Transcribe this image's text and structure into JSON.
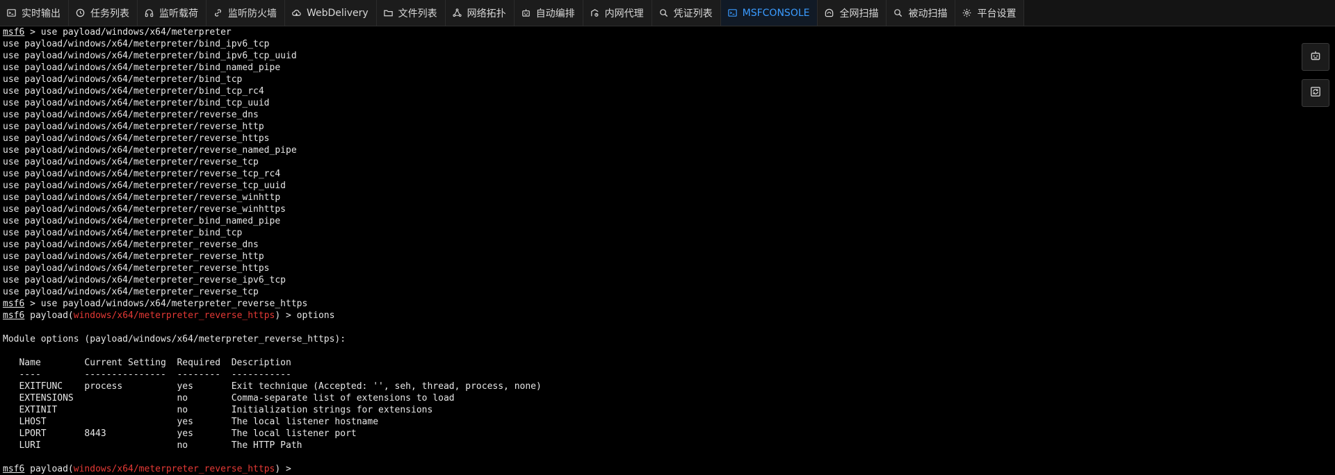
{
  "tabs": [
    {
      "label": "实时输出",
      "icon": "terminal-icon",
      "active": false
    },
    {
      "label": "任务列表",
      "icon": "clock-icon",
      "active": false
    },
    {
      "label": "监听载荷",
      "icon": "headphones-icon",
      "active": false
    },
    {
      "label": "监听防火墙",
      "icon": "link-icon",
      "active": false
    },
    {
      "label": "WebDelivery",
      "icon": "cloud-icon",
      "active": false
    },
    {
      "label": "文件列表",
      "icon": "folder-icon",
      "active": false
    },
    {
      "label": "网络拓扑",
      "icon": "network-icon",
      "active": false
    },
    {
      "label": "自动编排",
      "icon": "robot-icon",
      "active": false
    },
    {
      "label": "内网代理",
      "icon": "proxy-icon",
      "active": false
    },
    {
      "label": "凭证列表",
      "icon": "key-search-icon",
      "active": false
    },
    {
      "label": "MSFCONSOLE",
      "icon": "console-icon",
      "active": true
    },
    {
      "label": "全网扫描",
      "icon": "radar-icon",
      "active": false
    },
    {
      "label": "被动扫描",
      "icon": "search-icon",
      "active": false
    },
    {
      "label": "平台设置",
      "icon": "gear-icon",
      "active": false
    }
  ],
  "terminal": {
    "prompt": "msf6",
    "lines": [
      {
        "t": "prompt",
        "text": " > use payload/windows/x64/meterpreter"
      },
      {
        "t": "text",
        "text": "use payload/windows/x64/meterpreter/bind_ipv6_tcp"
      },
      {
        "t": "text",
        "text": "use payload/windows/x64/meterpreter/bind_ipv6_tcp_uuid"
      },
      {
        "t": "text",
        "text": "use payload/windows/x64/meterpreter/bind_named_pipe"
      },
      {
        "t": "text",
        "text": "use payload/windows/x64/meterpreter/bind_tcp"
      },
      {
        "t": "text",
        "text": "use payload/windows/x64/meterpreter/bind_tcp_rc4"
      },
      {
        "t": "text",
        "text": "use payload/windows/x64/meterpreter/bind_tcp_uuid"
      },
      {
        "t": "text",
        "text": "use payload/windows/x64/meterpreter/reverse_dns"
      },
      {
        "t": "text",
        "text": "use payload/windows/x64/meterpreter/reverse_http"
      },
      {
        "t": "text",
        "text": "use payload/windows/x64/meterpreter/reverse_https"
      },
      {
        "t": "text",
        "text": "use payload/windows/x64/meterpreter/reverse_named_pipe"
      },
      {
        "t": "text",
        "text": "use payload/windows/x64/meterpreter/reverse_tcp"
      },
      {
        "t": "text",
        "text": "use payload/windows/x64/meterpreter/reverse_tcp_rc4"
      },
      {
        "t": "text",
        "text": "use payload/windows/x64/meterpreter/reverse_tcp_uuid"
      },
      {
        "t": "text",
        "text": "use payload/windows/x64/meterpreter/reverse_winhttp"
      },
      {
        "t": "text",
        "text": "use payload/windows/x64/meterpreter/reverse_winhttps"
      },
      {
        "t": "text",
        "text": "use payload/windows/x64/meterpreter_bind_named_pipe"
      },
      {
        "t": "text",
        "text": "use payload/windows/x64/meterpreter_bind_tcp"
      },
      {
        "t": "text",
        "text": "use payload/windows/x64/meterpreter_reverse_dns"
      },
      {
        "t": "text",
        "text": "use payload/windows/x64/meterpreter_reverse_http"
      },
      {
        "t": "text",
        "text": "use payload/windows/x64/meterpreter_reverse_https"
      },
      {
        "t": "text",
        "text": "use payload/windows/x64/meterpreter_reverse_ipv6_tcp"
      },
      {
        "t": "text",
        "text": "use payload/windows/x64/meterpreter_reverse_tcp"
      },
      {
        "t": "prompt",
        "text": " > use payload/windows/x64/meterpreter_reverse_https"
      },
      {
        "t": "payload",
        "pre": " payload(",
        "module": "windows/x64/meterpreter_reverse_https",
        "post": ") > options"
      },
      {
        "t": "text",
        "text": ""
      },
      {
        "t": "text",
        "text": "Module options (payload/windows/x64/meterpreter_reverse_https):"
      },
      {
        "t": "text",
        "text": ""
      },
      {
        "t": "text",
        "text": "   Name        Current Setting  Required  Description"
      },
      {
        "t": "text",
        "text": "   ----        ---------------  --------  -----------"
      },
      {
        "t": "text",
        "text": "   EXITFUNC    process          yes       Exit technique (Accepted: '', seh, thread, process, none)"
      },
      {
        "t": "text",
        "text": "   EXTENSIONS                   no        Comma-separate list of extensions to load"
      },
      {
        "t": "text",
        "text": "   EXTINIT                      no        Initialization strings for extensions"
      },
      {
        "t": "text",
        "text": "   LHOST                        yes       The local listener hostname"
      },
      {
        "t": "text",
        "text": "   LPORT       8443             yes       The local listener port"
      },
      {
        "t": "text",
        "text": "   LURI                         no        The HTTP Path"
      },
      {
        "t": "text",
        "text": ""
      },
      {
        "t": "payload",
        "pre": " payload(",
        "module": "windows/x64/meterpreter_reverse_https",
        "post": ") > "
      }
    ]
  },
  "side_tools": [
    {
      "name": "robot-button",
      "icon": "robot-icon"
    },
    {
      "name": "refresh-button",
      "icon": "refresh-icon"
    }
  ],
  "colors": {
    "active_tab": "#3a9bff",
    "module_red": "#e53935",
    "background": "#000000"
  }
}
